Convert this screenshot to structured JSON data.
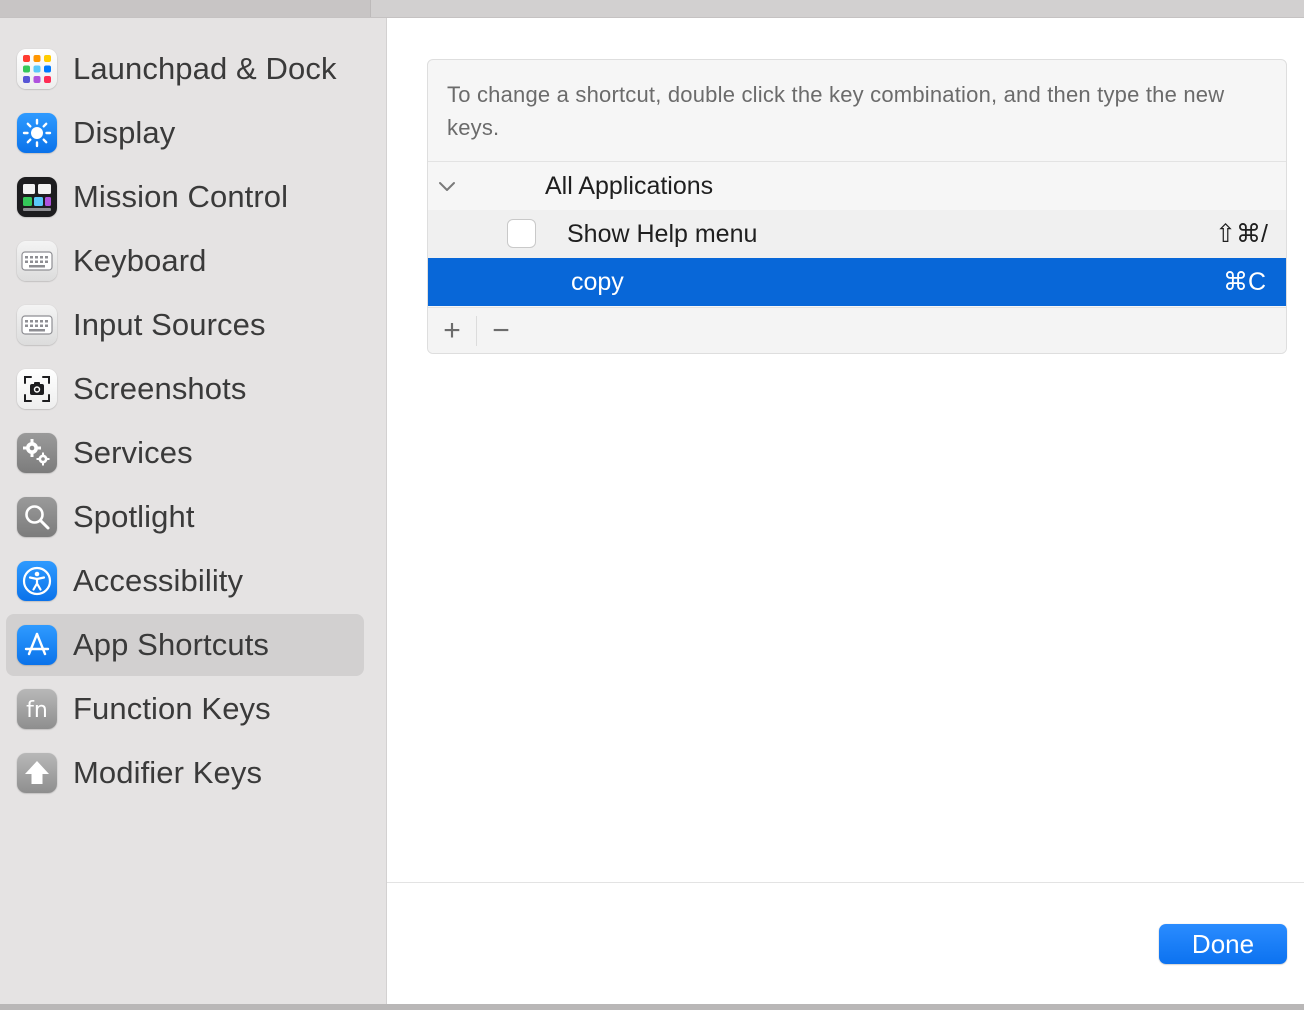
{
  "sidebar": {
    "items": [
      {
        "label": "Launchpad & Dock",
        "icon": "launchpad-icon"
      },
      {
        "label": "Display",
        "icon": "display-brightness-icon"
      },
      {
        "label": "Mission Control",
        "icon": "mission-control-icon"
      },
      {
        "label": "Keyboard",
        "icon": "keyboard-icon"
      },
      {
        "label": "Input Sources",
        "icon": "input-sources-icon"
      },
      {
        "label": "Screenshots",
        "icon": "screenshot-camera-icon"
      },
      {
        "label": "Services",
        "icon": "gears-icon"
      },
      {
        "label": "Spotlight",
        "icon": "magnifier-icon"
      },
      {
        "label": "Accessibility",
        "icon": "accessibility-icon"
      },
      {
        "label": "App Shortcuts",
        "icon": "app-store-icon",
        "selected": true
      },
      {
        "label": "Function Keys",
        "icon": "fn-icon"
      },
      {
        "label": "Modifier Keys",
        "icon": "shift-arrow-icon"
      }
    ]
  },
  "main": {
    "hint": "To change a shortcut, double click the key combination, and then type the new keys.",
    "group": {
      "label": "All Applications",
      "expanded": true
    },
    "rows": [
      {
        "label": "Show Help menu",
        "shortcut": "⇧⌘/",
        "checked": false
      },
      {
        "label": "copy",
        "shortcut": "⌘C",
        "selected": true
      }
    ],
    "toolbar": {
      "add": "+",
      "remove": "−"
    },
    "done_label": "Done"
  },
  "colors": {
    "accent": "#0867d8",
    "button": "#1a7ff5",
    "sidebar_bg": "#e5e3e3",
    "selected_item_bg": "#d2d0d0"
  }
}
